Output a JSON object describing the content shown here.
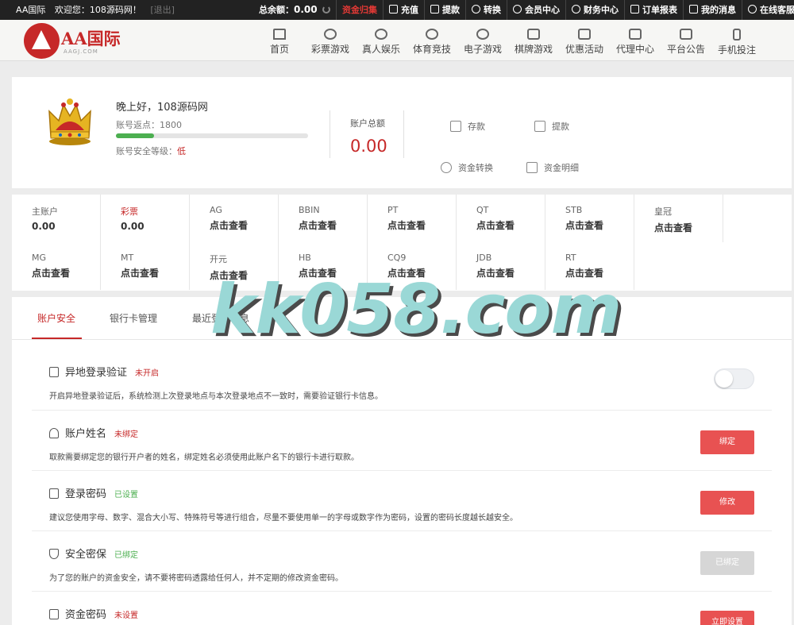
{
  "topbar": {
    "site": "AA国际",
    "welcome": "欢迎您：108源码网！",
    "logout": "[退出]",
    "balance_label": "总余额：",
    "balance_value": "0.00",
    "menu": [
      "资金归集",
      "充值",
      "提款",
      "转换",
      "会员中心",
      "财务中心",
      "订单报表",
      "我的消息",
      "在线客服"
    ],
    "menu_active_color": "#e53935"
  },
  "header": {
    "logo_text": "AA国际",
    "logo_sub": "AAGJ.COM",
    "nav": [
      "首页",
      "彩票游戏",
      "真人娱乐",
      "体育竞技",
      "电子游戏",
      "棋牌游戏",
      "优惠活动",
      "代理中心",
      "平台公告",
      "手机投注"
    ]
  },
  "account": {
    "greeting": "晚上好，108源码网",
    "rebate": "账号返点：1800",
    "security_progress": 0.2,
    "security_label": "账号安全等级：",
    "security_level": "低",
    "total_label": "账户总额",
    "total_value": "0.00",
    "actions": [
      "存款",
      "提款",
      "资金转换",
      "资金明细"
    ]
  },
  "wallets": [
    {
      "name": "主账户",
      "value": "0.00"
    },
    {
      "name": "彩票",
      "value": "0.00"
    },
    {
      "name": "AG",
      "value": "点击查看"
    },
    {
      "name": "BBIN",
      "value": "点击查看"
    },
    {
      "name": "PT",
      "value": "点击查看"
    },
    {
      "name": "QT",
      "value": "点击查看"
    },
    {
      "name": "STB",
      "value": "点击查看"
    },
    {
      "name": "皇冠",
      "value": "点击查看"
    },
    {
      "name": "MG",
      "value": "点击查看"
    },
    {
      "name": "MT",
      "value": "点击查看"
    },
    {
      "name": "开元",
      "value": "点击查看"
    },
    {
      "name": "HB",
      "value": "点击查看"
    },
    {
      "name": "CQ9",
      "value": "点击查看"
    },
    {
      "name": "JDB",
      "value": "点击查看"
    },
    {
      "name": "RT",
      "value": "点击查看"
    }
  ],
  "tabs": [
    "账户安全",
    "银行卡管理",
    "最近登录信息"
  ],
  "security": [
    {
      "title": "异地登录验证",
      "status": "未开启",
      "desc": "开启异地登录验证后，系统检测上次登录地点与本次登录地点不一致时，需要验证银行卡信息。",
      "control": "toggle"
    },
    {
      "title": "账户姓名",
      "status": "未绑定",
      "desc": "取款需要绑定您的银行开户者的姓名，绑定姓名必须使用此账户名下的银行卡进行取款。",
      "button": "绑定"
    },
    {
      "title": "登录密码",
      "status": "已设置",
      "desc": "建议您使用字母、数字、混合大小写、特殊符号等进行组合，尽量不要使用单一的字母或数字作为密码，设置的密码长度越长越安全。",
      "button": "修改"
    },
    {
      "title": "安全密保",
      "status": "已绑定",
      "desc": "为了您的账户的资金安全，请不要将密码透露给任何人，并不定期的修改资金密码。",
      "button": "已绑定"
    },
    {
      "title": "资金密码",
      "status": "未设置",
      "desc": "",
      "button": "立即设置"
    }
  ],
  "watermark": "kk058.com",
  "colors": {
    "accent": "#c62828",
    "button": "#e85252",
    "success": "#4caf50"
  }
}
